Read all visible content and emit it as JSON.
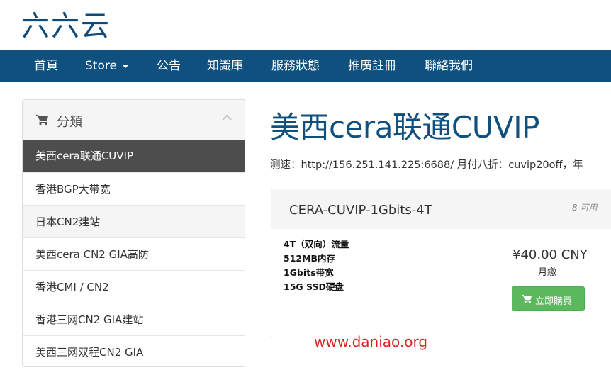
{
  "logo": "六六云",
  "nav": [
    {
      "label": "首頁"
    },
    {
      "label": "Store"
    },
    {
      "label": "公告"
    },
    {
      "label": "知識庫"
    },
    {
      "label": "服務狀態"
    },
    {
      "label": "推廣註冊"
    },
    {
      "label": "聯絡我們"
    }
  ],
  "sidebar": {
    "title": "分類",
    "items": [
      {
        "label": "美西cera联通CUVIP"
      },
      {
        "label": "香港BGP大带宽"
      },
      {
        "label": "日本CN2建站"
      },
      {
        "label": "美西cera CN2 GIA高防"
      },
      {
        "label": "香港CMI / CN2"
      },
      {
        "label": "香港三网CN2 GIA建站"
      },
      {
        "label": "美西三网双程CN2 GIA"
      }
    ]
  },
  "main": {
    "title": "美西cera联通CUVIP",
    "description": "测速：http://156.251.141.225:6688/ 月付八折：cuvip20off，年"
  },
  "product": {
    "name": "CERA-CUVIP-1Gbits-4T",
    "availability": "8 可用",
    "features": [
      "4T（双向）流量",
      "512MB内存",
      "1Gbits带宽",
      "15G SSD硬盘"
    ],
    "price": "¥40.00 CNY",
    "cycle": "月繳",
    "buy_label": "立即購買"
  },
  "watermark": "www.daniao.org",
  "colors": {
    "brand": "#10507f",
    "active_item": "#4d4d4d",
    "buy_button": "#5cb85c",
    "watermark": "#e02020"
  }
}
